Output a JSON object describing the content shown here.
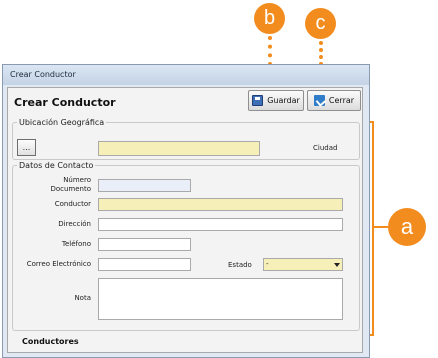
{
  "window": {
    "title": "Crear Conductor"
  },
  "form": {
    "heading": "Crear Conductor"
  },
  "toolbar": {
    "save_label": "Guardar",
    "close_label": "Cerrar"
  },
  "location_group": {
    "legend": "Ubicación Geográfica",
    "picker_label": "...",
    "city_value": "",
    "city_label": "Ciudad"
  },
  "contact_group": {
    "legend": "Datos de Contacto",
    "fields": {
      "document_number": {
        "label_line1": "Número",
        "label_line2": "Documento",
        "value": ""
      },
      "driver": {
        "label": "Conductor",
        "value": ""
      },
      "address": {
        "label": "Dirección",
        "value": ""
      },
      "phone": {
        "label": "Teléfono",
        "value": ""
      },
      "email": {
        "label": "Correo Electrónico",
        "value": ""
      },
      "status": {
        "label": "Estado",
        "value": "-"
      },
      "note": {
        "label": "Nota",
        "value": ""
      }
    }
  },
  "footer": {
    "label": "Conductores"
  },
  "annotations": {
    "a": "a",
    "b": "b",
    "c": "c"
  },
  "colors": {
    "callout": "#f28c1e",
    "required_field": "#f6f0b8"
  }
}
